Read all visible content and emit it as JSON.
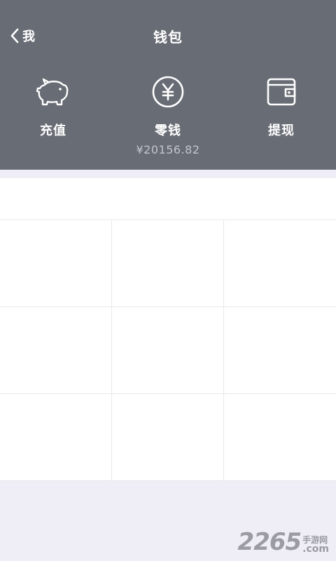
{
  "nav": {
    "back_label": "我",
    "title": "钱包"
  },
  "actions": [
    {
      "label": "充值",
      "icon": "piggy-bank-icon"
    },
    {
      "label": "零钱",
      "icon": "yuan-coin-icon",
      "amount": "¥20156.82"
    },
    {
      "label": "提现",
      "icon": "wallet-icon"
    }
  ],
  "watermark": {
    "number": "2265",
    "suffix_cn": "手游网",
    "suffix_com": ".com"
  },
  "colors": {
    "header_bg": "#686c74",
    "page_bg": "#efedf5",
    "amount_text": "#c2c5cb"
  }
}
